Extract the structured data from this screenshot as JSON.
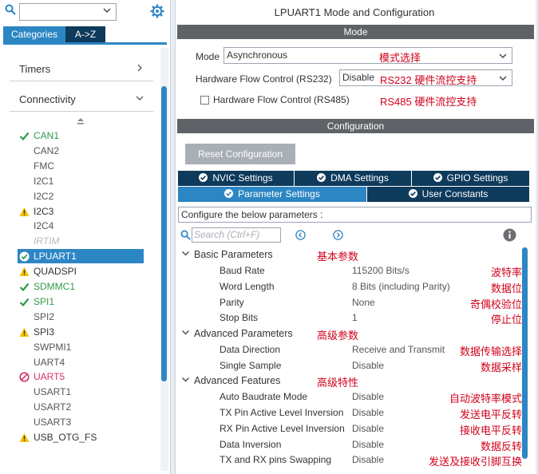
{
  "left": {
    "search": {
      "value": "",
      "placeholder": ""
    },
    "tabs": {
      "categories": "Categories",
      "az": "A->Z"
    },
    "sections": {
      "timers": "Timers",
      "connectivity": "Connectivity"
    },
    "peripherals": [
      {
        "name": "CAN1",
        "status": "ok"
      },
      {
        "name": "CAN2",
        "status": "none"
      },
      {
        "name": "FMC",
        "status": "none"
      },
      {
        "name": "I2C1",
        "status": "none"
      },
      {
        "name": "I2C2",
        "status": "none"
      },
      {
        "name": "I2C3",
        "status": "warn"
      },
      {
        "name": "I2C4",
        "status": "none"
      },
      {
        "name": "IRTIM",
        "status": "disabled"
      },
      {
        "name": "LPUART1",
        "status": "selected"
      },
      {
        "name": "QUADSPI",
        "status": "warn"
      },
      {
        "name": "SDMMC1",
        "status": "ok"
      },
      {
        "name": "SPI1",
        "status": "ok"
      },
      {
        "name": "SPI2",
        "status": "none"
      },
      {
        "name": "SPI3",
        "status": "warn"
      },
      {
        "name": "SWPMI1",
        "status": "none"
      },
      {
        "name": "UART4",
        "status": "none"
      },
      {
        "name": "UART5",
        "status": "blocked"
      },
      {
        "name": "USART1",
        "status": "none"
      },
      {
        "name": "USART2",
        "status": "none"
      },
      {
        "name": "USART3",
        "status": "none"
      },
      {
        "name": "USB_OTG_FS",
        "status": "warn"
      }
    ]
  },
  "right": {
    "title": "LPUART1 Mode and Configuration",
    "mode_bar": "Mode",
    "mode": {
      "mode_label": "Mode",
      "mode_value": "Asynchronous",
      "mode_note": "模式选择",
      "hw232_label": "Hardware Flow Control (RS232)",
      "hw232_value": "Disable",
      "hw232_note": "RS232 硬件流控支持",
      "hw485_label": "Hardware Flow Control (RS485)",
      "hw485_note": "RS485 硬件流控支持"
    },
    "config_bar": "Configuration",
    "reset_button": "Reset Configuration",
    "tabs": {
      "nvic": "NVIC Settings",
      "dma": "DMA Settings",
      "gpio": "GPIO Settings",
      "param": "Parameter Settings",
      "user": "User Constants"
    },
    "config_desc": "Configure the below parameters :",
    "param_search_placeholder": "Search (Ctrl+F)",
    "groups": {
      "basic": {
        "label": "Basic Parameters",
        "note": "基本参数"
      },
      "advanced": {
        "label": "Advanced Parameters",
        "note": "高级参数"
      },
      "features": {
        "label": "Advanced Features",
        "note": "高级特性"
      }
    },
    "params": [
      {
        "name": "Baud Rate",
        "value": "115200 Bits/s",
        "note": "波特率"
      },
      {
        "name": "Word Length",
        "value": "8 Bits (including Parity)",
        "note": "数据位"
      },
      {
        "name": "Parity",
        "value": "None",
        "note": "奇偶校验位"
      },
      {
        "name": "Stop Bits",
        "value": "1",
        "note": "停止位"
      },
      {
        "name": "Data Direction",
        "value": "Receive and Transmit",
        "note": "数据传输选择"
      },
      {
        "name": "Single Sample",
        "value": "Disable",
        "note": "数据采样"
      },
      {
        "name": "Auto Baudrate Mode",
        "value": "Disable",
        "note": "自动波特率模式"
      },
      {
        "name": "TX Pin Active Level Inversion",
        "value": "Disable",
        "note": "发送电平反转"
      },
      {
        "name": "RX Pin Active Level Inversion",
        "value": "Disable",
        "note": "接收电平反转"
      },
      {
        "name": "Data Inversion",
        "value": "Disable",
        "note": "数据反转"
      },
      {
        "name": "TX and RX pins Swapping",
        "value": "Disable",
        "note": "发送及接收引脚互换"
      }
    ]
  },
  "colors": {
    "accent": "#2d86c4",
    "navy": "#0e3a5c",
    "bar": "#5f6368",
    "note": "#d0021b",
    "ok": "#2e9b49",
    "warn": "#f5c400",
    "blocked": "#d1346e"
  }
}
